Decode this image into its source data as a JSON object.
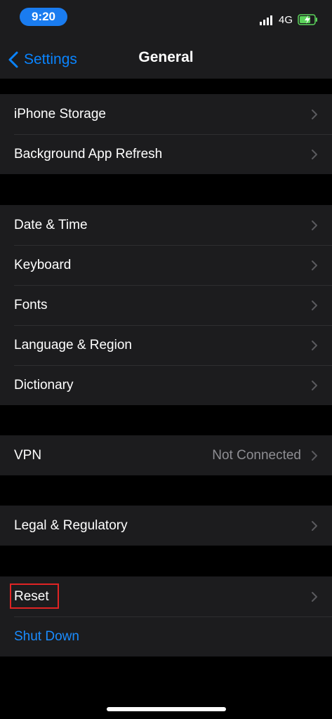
{
  "status_bar": {
    "time": "9:20",
    "network": "4G",
    "icons": [
      "signal-bars-icon",
      "battery-charging-icon"
    ]
  },
  "nav": {
    "back_label": "Settings",
    "title": "General"
  },
  "groups": [
    {
      "rows": [
        {
          "label": "iPhone Storage"
        },
        {
          "label": "Background App Refresh"
        }
      ]
    },
    {
      "rows": [
        {
          "label": "Date & Time"
        },
        {
          "label": "Keyboard"
        },
        {
          "label": "Fonts"
        },
        {
          "label": "Language & Region"
        },
        {
          "label": "Dictionary"
        }
      ]
    },
    {
      "rows": [
        {
          "label": "VPN",
          "value": "Not Connected"
        }
      ]
    },
    {
      "rows": [
        {
          "label": "Legal & Regulatory"
        }
      ]
    },
    {
      "rows": [
        {
          "label": "Reset",
          "highlighted": true
        },
        {
          "label": "Shut Down"
        }
      ]
    }
  ],
  "colors": {
    "accent": "#0a84ff",
    "background": "#000000",
    "cell": "#1c1c1e",
    "highlight": "#e02424"
  }
}
